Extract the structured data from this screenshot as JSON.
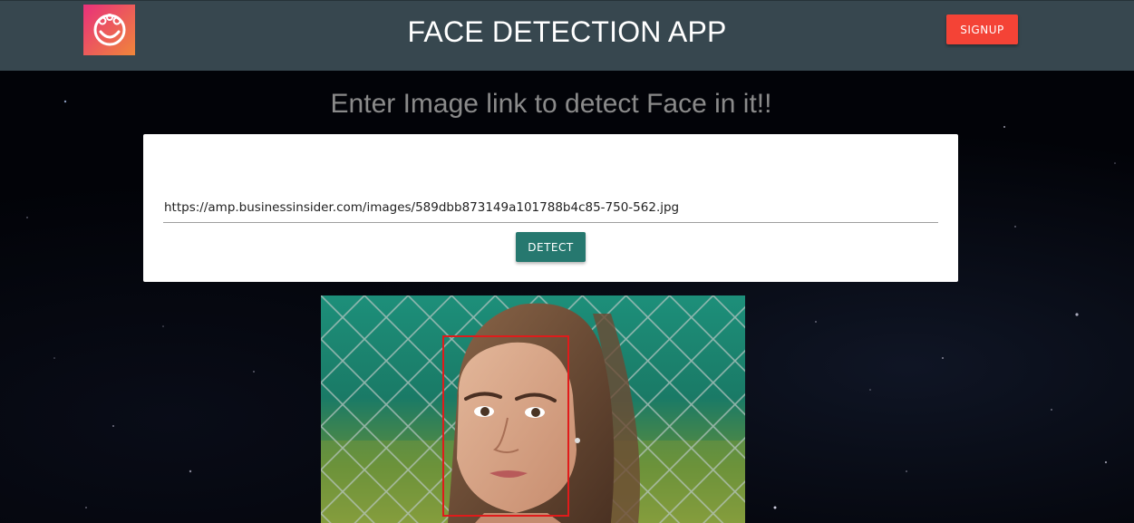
{
  "header": {
    "title": "FACE DETECTION APP",
    "logo_icon": "face-detection-logo-icon",
    "signup_label": "SIGNUP",
    "background_color": "#37474f"
  },
  "main": {
    "prompt": "Enter Image link to detect Face in it!!",
    "image_url_value": "https://amp.businessinsider.com/images/589dbb873149a101788b4c85-750-562.jpg",
    "detect_label": "DETECT",
    "detect_color": "#26786f",
    "signup_color": "#f44336",
    "face_box_color": "#e01b1b"
  }
}
